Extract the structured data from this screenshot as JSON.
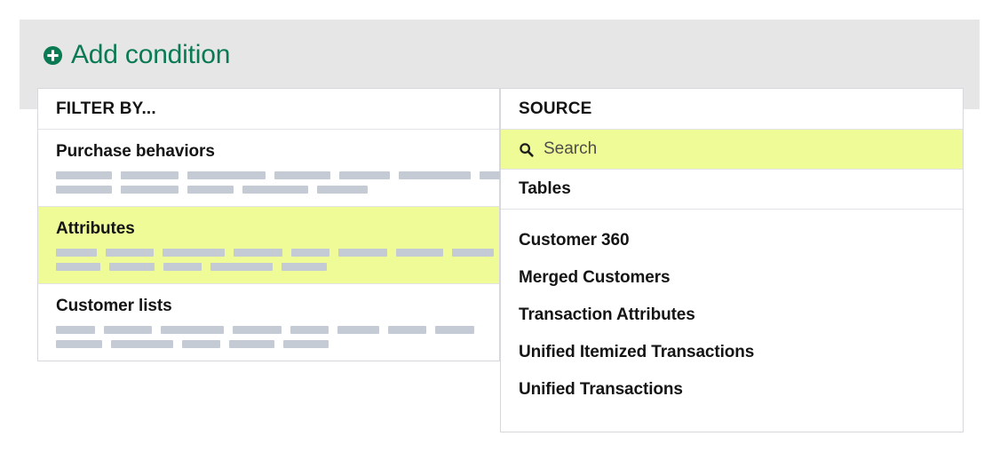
{
  "header": {
    "add_condition_label": "Add condition",
    "plus_icon": "plus-circle-icon",
    "accent_color": "#0a7a52",
    "band_color": "#e6e6e6"
  },
  "filter_panel": {
    "header_label": "FILTER BY...",
    "highlight_color": "#effb96",
    "bar_color": "#c4cbd4",
    "groups": [
      {
        "title": "Purchase behaviors",
        "selected": false,
        "bar_rows": [
          [
            63,
            65,
            88,
            63,
            57,
            81,
            63
          ],
          [
            63,
            65,
            52,
            74,
            57
          ]
        ]
      },
      {
        "title": "Attributes",
        "selected": true,
        "bar_rows": [
          [
            46,
            54,
            70,
            55,
            43,
            55,
            53,
            47,
            44
          ],
          [
            50,
            51,
            43,
            70,
            51
          ]
        ]
      },
      {
        "title": "Customer lists",
        "selected": false,
        "bar_rows": [
          [
            44,
            54,
            71,
            55,
            43,
            47,
            43,
            44
          ],
          [
            52,
            70,
            43,
            51,
            51
          ]
        ]
      }
    ]
  },
  "source_panel": {
    "header_label": "SOURCE",
    "search": {
      "icon": "search-icon",
      "placeholder": "Search",
      "value": "",
      "highlighted": true
    },
    "tables_label": "Tables",
    "items": [
      "Customer 360",
      "Merged Customers",
      "Transaction Attributes",
      "Unified Itemized Transactions",
      "Unified Transactions"
    ]
  }
}
